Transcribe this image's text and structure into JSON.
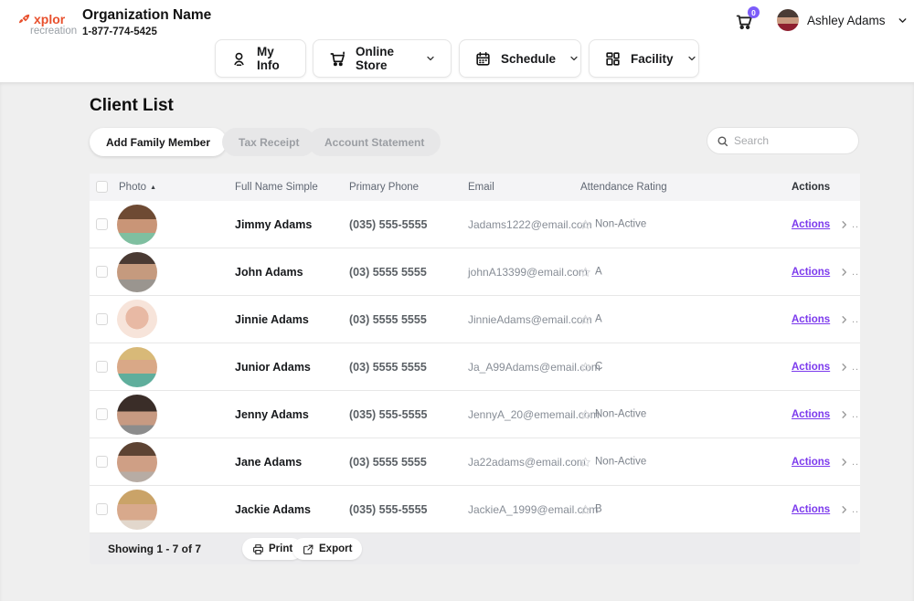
{
  "colors": {
    "brand_orange": "#e8502d",
    "accent_purple": "#7c3aed",
    "badge_purple": "#7c5cfa",
    "body_bg": "#efefef",
    "table_header_bg": "#f4f4f6",
    "footer_bg": "#ececee"
  },
  "header": {
    "logo": {
      "brand": "xplor",
      "sub": "recreation",
      "icon": "rocket-icon"
    },
    "org_name": "Organization Name",
    "org_phone": "1-877-774-5425",
    "nav": [
      {
        "label": "My Info",
        "icon": "person-icon",
        "has_dropdown": false
      },
      {
        "label": "Online Store",
        "icon": "cart-icon",
        "has_dropdown": true
      },
      {
        "label": "Schedule",
        "icon": "calendar-icon",
        "has_dropdown": true
      },
      {
        "label": "Facility",
        "icon": "grid-icon",
        "has_dropdown": true
      }
    ],
    "cart_badge": "0",
    "user_name": "Ashley Adams",
    "user_avatar_style": "background:linear-gradient(180deg,#4a3b35 0%,#4a3b35 38%,#c99a80 38%,#c99a80 66%,#8e1f2f 66%)"
  },
  "page": {
    "title": "Client List",
    "buttons": [
      {
        "label": "Add Family Member"
      },
      {
        "label": "Tax Receipt"
      },
      {
        "label": "Account Statement"
      }
    ],
    "search_placeholder": "Search"
  },
  "table": {
    "columns": [
      "Photo",
      "Full Name Simple",
      "Primary Phone",
      "Email",
      "Attendance Rating",
      "Actions"
    ],
    "sort_column": "Photo",
    "sort_asc_icon": "▲",
    "more_hint": "..",
    "actions_label": "Actions",
    "rows": [
      {
        "name": "Jimmy Adams",
        "phone": "(035) 555-5555",
        "email": "Jadams1222@email.com",
        "rating": "Non-Active",
        "avatar_style": "background:linear-gradient(180deg,#6e4a33 0%,#6e4a33 36%,#c99577 36%,#c99577 70%,#7fbfa0 70%)"
      },
      {
        "name": "John Adams",
        "phone": "(03) 5555 5555",
        "email": "johnA13399@email.com",
        "rating": "A",
        "avatar_style": "background:linear-gradient(180deg,#4a3a33 0%,#4a3a33 30%,#c59a7e 30%,#c59a7e 68%,#9a958f 68%)"
      },
      {
        "name": "Jinnie Adams",
        "phone": "(03) 5555 5555",
        "email": "JinnieAdams@email.com",
        "rating": "A",
        "avatar_style": "background:radial-gradient(circle at 50% 45%,#e8b9a4 0 38%,#f7e4da 39% 68%,#ffffff 69%)"
      },
      {
        "name": "Junior Adams",
        "phone": "(03) 5555 5555",
        "email": "Ja_A99Adams@email.com",
        "rating": "C",
        "avatar_style": "background:linear-gradient(180deg,#d8b978 0%,#d8b978 32%,#d9a887 32%,#d9a887 66%,#5fae9c 66%)"
      },
      {
        "name": "Jenny Adams",
        "phone": "(035) 555-5555",
        "email": "JennyA_20@ememail.com",
        "rating": "Non-Active",
        "avatar_style": "background:linear-gradient(180deg,#3a2d28 0%,#3a2d28 42%,#c79a82 42%,#c79a82 76%,#8c8c8c 76%)"
      },
      {
        "name": "Jane Adams",
        "phone": "(03) 5555 5555",
        "email": "Ja22adams@email.com",
        "rating": "Non-Active",
        "avatar_style": "background:linear-gradient(180deg,#5d4333 0%,#5d4333 34%,#cf9f85 34%,#cf9f85 74%,#b7aca4 74%)"
      },
      {
        "name": "Jackie Adams",
        "phone": "(035) 555-5555",
        "email": "JackieA_1999@email.com",
        "rating": "B",
        "avatar_style": "background:linear-gradient(180deg,#caa368 0%,#caa368 36%,#d8a98c 36%,#d8a98c 76%,#e2d7cc 76%)"
      }
    ],
    "footer": {
      "showing": "Showing 1 - 7 of 7",
      "print_label": "Print",
      "export_label": "Export"
    }
  }
}
